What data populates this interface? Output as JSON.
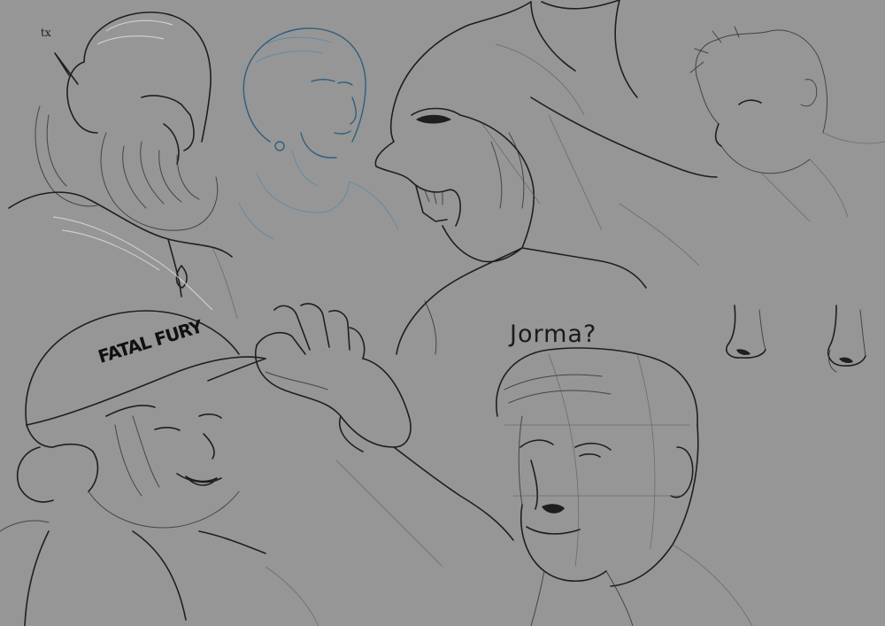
{
  "image": {
    "background": "#969696",
    "ink": "#1f1f1f",
    "accent_blue": "#2f5f7e"
  },
  "labels": {
    "jorma_caption": "Jorma?",
    "signature": "tx",
    "cap_logo_text": "FATAL FURY"
  },
  "sketches": [
    "bearded-elf-man",
    "bob-haired-woman",
    "masked-wolverine",
    "young-man-profile",
    "nose-studies",
    "cap-wearing-fighter",
    "jorma-head-study"
  ]
}
